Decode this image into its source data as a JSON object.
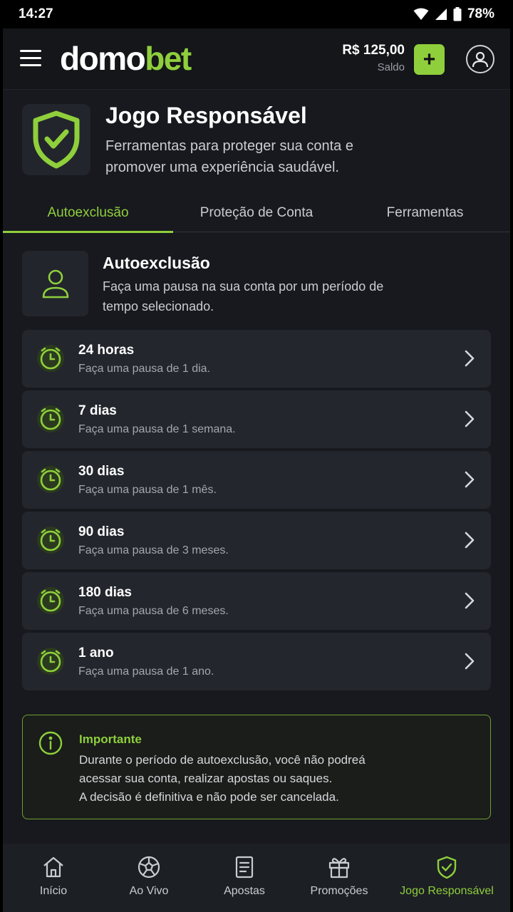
{
  "status_bar": {
    "time": "14:27",
    "battery": "78%"
  },
  "header": {
    "logo_part1": "domo",
    "logo_part2": "bet",
    "balance_amount": "R$ 125,00",
    "balance_label": "Saldo",
    "add_label": "+"
  },
  "page": {
    "title": "Jogo Responsável",
    "subtitle": "Ferramentas para proteger sua conta e promover uma experiência saudável."
  },
  "tabs": [
    {
      "label": "Autoexclusão",
      "active": true
    },
    {
      "label": "Proteção de Conta",
      "active": false
    },
    {
      "label": "Ferramentas",
      "active": false
    }
  ],
  "section": {
    "title": "Autoexclusão",
    "subtitle": "Faça uma pausa na sua conta por um período de tempo selecionado."
  },
  "options": [
    {
      "title": "24 horas",
      "desc": "Faça uma pausa de 1 dia."
    },
    {
      "title": "7 dias",
      "desc": "Faça uma pausa de 1 semana."
    },
    {
      "title": "30 dias",
      "desc": "Faça uma pausa de 1 mês."
    },
    {
      "title": "90 dias",
      "desc": "Faça uma pausa de 3 meses."
    },
    {
      "title": "180 dias",
      "desc": "Faça uma pausa de 6 meses."
    },
    {
      "title": "1 ano",
      "desc": "Faça uma pausa de 1 ano."
    }
  ],
  "notice": {
    "title": "Importante",
    "line1": "Durante o período de autoexclusão, você não podreá",
    "line2": "acessar sua conta, realizar apostas ou saques.",
    "line3": "A decisão é definitiva e não pode ser cancelada."
  },
  "bottom_nav": [
    {
      "label": "Início",
      "icon": "home-icon"
    },
    {
      "label": "Ao Vivo",
      "icon": "soccer-ball-icon"
    },
    {
      "label": "Apostas",
      "icon": "betslip-icon"
    },
    {
      "label": "Promoções",
      "icon": "gift-icon"
    },
    {
      "label": "Jogo Responsável",
      "icon": "shield-check-icon",
      "active": true
    }
  ],
  "colors": {
    "accent": "#8fcf3c",
    "background": "#17191e",
    "card": "#23262c"
  }
}
